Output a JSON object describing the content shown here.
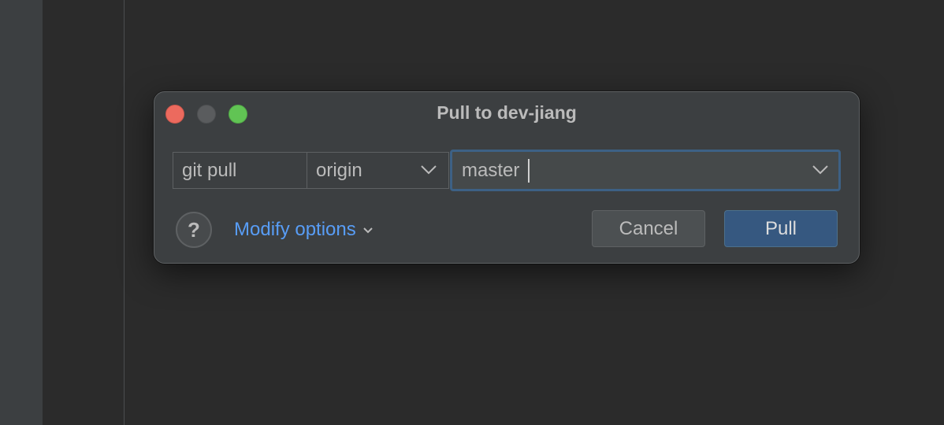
{
  "dialog": {
    "title": "Pull to dev-jiang",
    "command_label": "git pull",
    "remote": {
      "selected": "origin"
    },
    "branch": {
      "value": "master"
    },
    "help_label": "?",
    "modify_options_label": "Modify options",
    "cancel_label": "Cancel",
    "pull_label": "Pull"
  },
  "icons": {
    "help": "question-mark-icon",
    "remote_dropdown": "chevron-down-icon",
    "branch_dropdown": "chevron-down-icon",
    "modify_options_dropdown": "chevron-down-icon"
  },
  "colors": {
    "background": "#2b2b2b",
    "dialog": "#3c3f41",
    "accent_link": "#589df6",
    "primary_button": "#365880",
    "focus_border": "#3d6185",
    "traffic_close": "#ec6a5e",
    "traffic_zoom": "#61c454"
  }
}
